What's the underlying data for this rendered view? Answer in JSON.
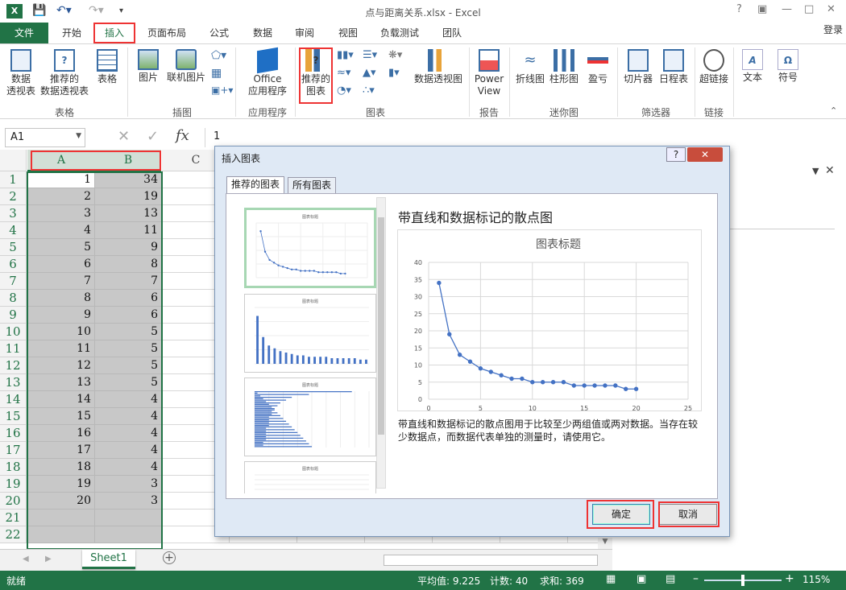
{
  "window": {
    "title": "点与距离关系.xlsx - Excel",
    "help": "?",
    "login": "登录"
  },
  "tabs": [
    "文件",
    "开始",
    "插入",
    "页面布局",
    "公式",
    "数据",
    "审阅",
    "视图",
    "负载测试",
    "团队"
  ],
  "ribbon": {
    "pivot": "数据\n透视表",
    "rec_pivot": "推荐的\n数据透视表",
    "table": "表格",
    "picture": "图片",
    "online_pic": "联机图片",
    "office_apps": "Office\n应用程序",
    "rec_charts": "推荐的\n图表",
    "pivot_chart": "数据透视图",
    "power_view": "Power\nView",
    "line": "折线图",
    "column": "柱形图",
    "winloss": "盈亏",
    "slicer": "切片器",
    "timeline": "日程表",
    "hyperlink": "超链接",
    "text": "文本",
    "symbol": "符号",
    "groups": {
      "tables": "表格",
      "illus": "插图",
      "apps": "应用程序",
      "charts": "图表",
      "reports": "报告",
      "sparklines": "迷你图",
      "filters": "筛选器",
      "links": "链接"
    }
  },
  "formula": {
    "namebox": "A1",
    "fx": "fx",
    "value": "1"
  },
  "columns": [
    "A",
    "B",
    "C"
  ],
  "rows": [
    {
      "n": "1",
      "a": "1",
      "b": "34"
    },
    {
      "n": "2",
      "a": "2",
      "b": "19"
    },
    {
      "n": "3",
      "a": "3",
      "b": "13"
    },
    {
      "n": "4",
      "a": "4",
      "b": "11"
    },
    {
      "n": "5",
      "a": "5",
      "b": "9"
    },
    {
      "n": "6",
      "a": "6",
      "b": "8"
    },
    {
      "n": "7",
      "a": "7",
      "b": "7"
    },
    {
      "n": "8",
      "a": "8",
      "b": "6"
    },
    {
      "n": "9",
      "a": "9",
      "b": "6"
    },
    {
      "n": "10",
      "a": "10",
      "b": "5"
    },
    {
      "n": "11",
      "a": "11",
      "b": "5"
    },
    {
      "n": "12",
      "a": "12",
      "b": "5"
    },
    {
      "n": "13",
      "a": "13",
      "b": "5"
    },
    {
      "n": "14",
      "a": "14",
      "b": "4"
    },
    {
      "n": "15",
      "a": "15",
      "b": "4"
    },
    {
      "n": "16",
      "a": "16",
      "b": "4"
    },
    {
      "n": "17",
      "a": "17",
      "b": "4"
    },
    {
      "n": "18",
      "a": "18",
      "b": "4"
    },
    {
      "n": "19",
      "a": "19",
      "b": "3"
    },
    {
      "n": "20",
      "a": "20",
      "b": "3"
    },
    {
      "n": "21",
      "a": "",
      "b": ""
    },
    {
      "n": "22",
      "a": "",
      "b": ""
    }
  ],
  "sheet": {
    "name": "Sheet1"
  },
  "status": {
    "ready": "就绪",
    "avg": "平均值: 9.225",
    "count": "计数: 40",
    "sum": "求和: 369",
    "zoom": "115%"
  },
  "dialog": {
    "title": "插入图表",
    "help": "?",
    "tab_rec": "推荐的图表",
    "tab_all": "所有图表",
    "chart_name": "带直线和数据标记的散点图",
    "description": "带直线和数据标记的散点图用于比较至少两组值或两对数据。当存在较少数据点，而数据代表单独的测量时，请使用它。",
    "ok": "确定",
    "cancel": "取消",
    "thumb_title": "图表标题"
  },
  "chart_data": {
    "type": "scatter",
    "title": "图表标题",
    "x": [
      1,
      2,
      3,
      4,
      5,
      6,
      7,
      8,
      9,
      10,
      11,
      12,
      13,
      14,
      15,
      16,
      17,
      18,
      19,
      20
    ],
    "y": [
      34,
      19,
      13,
      11,
      9,
      8,
      7,
      6,
      6,
      5,
      5,
      5,
      5,
      4,
      4,
      4,
      4,
      4,
      3,
      3
    ],
    "xlim": [
      0,
      25
    ],
    "ylim": [
      0,
      40
    ],
    "xticks": [
      0,
      5,
      10,
      15,
      20,
      25
    ],
    "yticks": [
      0,
      5,
      10,
      15,
      20,
      25,
      30,
      35,
      40
    ],
    "grid": true,
    "color": "#4472c4"
  }
}
